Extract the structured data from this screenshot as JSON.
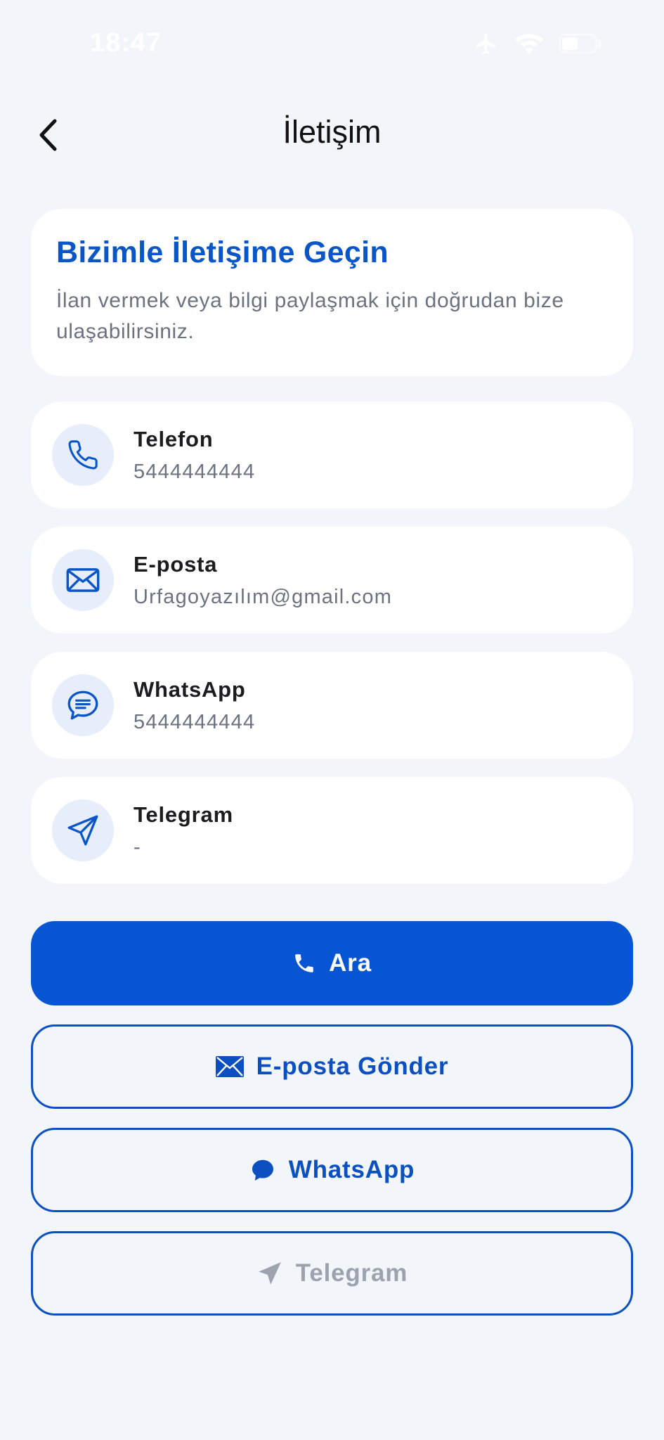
{
  "status_bar": {
    "time": "18:47"
  },
  "header": {
    "title": "İletişim"
  },
  "intro": {
    "title": "Bizimle İletişime Geçin",
    "text": "İlan vermek veya bilgi paylaşmak için doğrudan bize ulaşabilirsiniz."
  },
  "contacts": [
    {
      "label": "Telefon",
      "value": "5444444444",
      "icon": "phone-icon"
    },
    {
      "label": "E-posta",
      "value": "Urfagoyazılım@gmail.com",
      "icon": "mail-icon"
    },
    {
      "label": "WhatsApp",
      "value": "5444444444",
      "icon": "chat-icon"
    },
    {
      "label": "Telegram",
      "value": "-",
      "icon": "send-icon"
    }
  ],
  "actions": {
    "call": "Ara",
    "email": "E-posta Gönder",
    "whatsapp": "WhatsApp",
    "telegram": "Telegram"
  },
  "colors": {
    "background": "#f2f5f9",
    "primary": "#0656d4",
    "icon_bg": "#e7eefb",
    "disabled_text": "#9ca3af"
  }
}
